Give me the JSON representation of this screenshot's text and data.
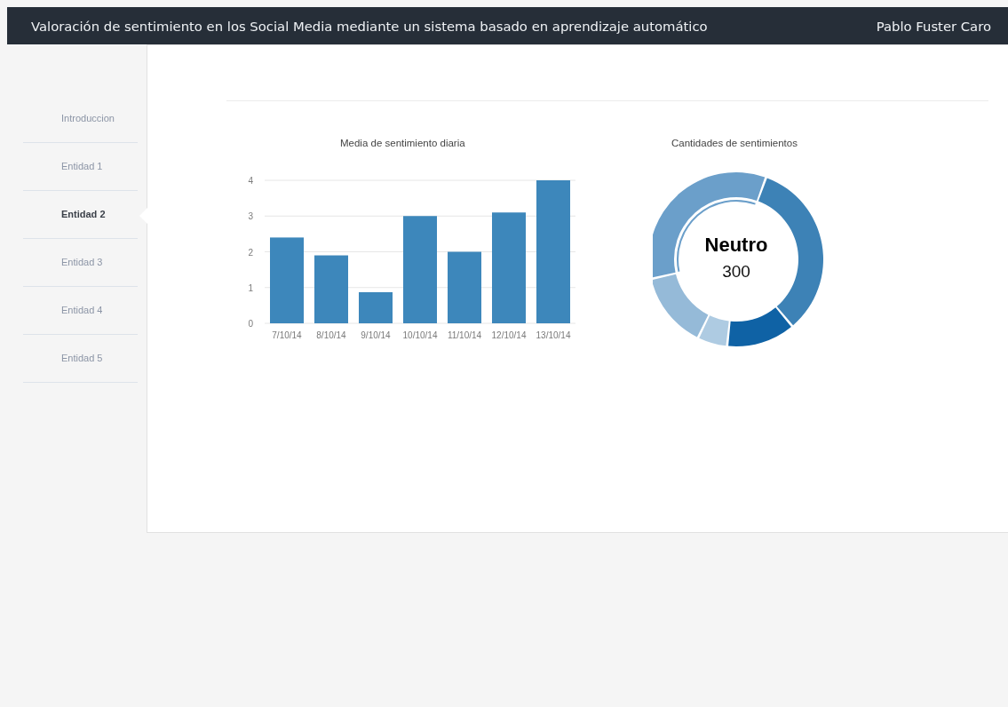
{
  "header": {
    "title": "Valoración de sentimiento en los Social Media mediante un sistema basado en aprendizaje automático",
    "user": "Pablo Fuster Caro"
  },
  "sidebar": {
    "items": [
      {
        "label": "Introduccion",
        "selected": false
      },
      {
        "label": "Entidad 1",
        "selected": false
      },
      {
        "label": "Entidad 2",
        "selected": true
      },
      {
        "label": "Entidad 3",
        "selected": false
      },
      {
        "label": "Entidad 4",
        "selected": false
      },
      {
        "label": "Entidad 5",
        "selected": false
      }
    ]
  },
  "bar_chart": {
    "chart_data": {
      "type": "bar",
      "title": "Media de sentimiento diaria",
      "categories": [
        "7/10/14",
        "8/10/14",
        "9/10/14",
        "10/10/14",
        "11/10/14",
        "12/10/14",
        "13/10/14"
      ],
      "series": [
        {
          "color": "#3d87bb",
          "values": [
            2.4,
            1.9,
            0.87,
            3.0,
            2.0,
            3.1,
            4.0
          ]
        }
      ],
      "ylim": [
        0,
        4
      ],
      "yticks": [
        0,
        1,
        2,
        3,
        4
      ],
      "grid": true
    }
  },
  "donut": {
    "title": "Cantidades de sentimientos",
    "center_label": "Neutro",
    "center_value": "300"
  }
}
